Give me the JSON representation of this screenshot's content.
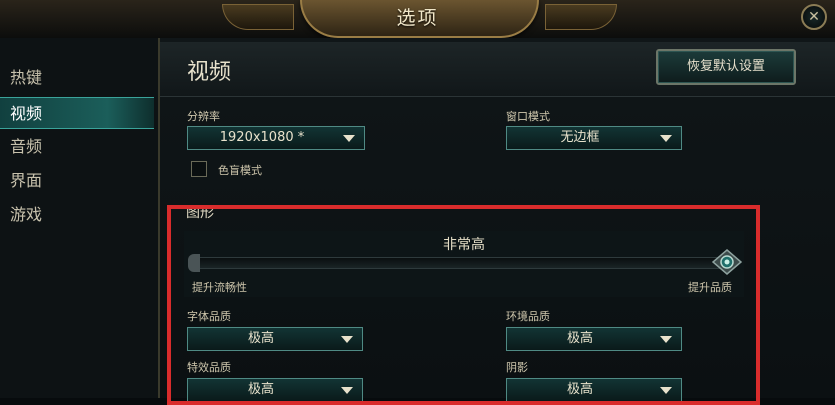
{
  "window": {
    "title": "选项",
    "close_icon": "✕"
  },
  "sidebar": {
    "items": [
      {
        "label": "热键"
      },
      {
        "label": "视频"
      },
      {
        "label": "音频"
      },
      {
        "label": "界面"
      },
      {
        "label": "游戏"
      }
    ],
    "active": "视频"
  },
  "header": {
    "title": "视频",
    "restore_defaults": "恢复默认设置"
  },
  "resolution": {
    "label": "分辨率",
    "value": "1920x1080 *"
  },
  "window_mode": {
    "label": "窗口模式",
    "value": "无边框"
  },
  "colorblind": {
    "label": "色盲模式",
    "checked": false
  },
  "graphics": {
    "title": "图形",
    "quality_level": "非常高",
    "slider_value_fraction": 1.0,
    "min_label": "提升流畅性",
    "max_label": "提升品质"
  },
  "settings": {
    "character_quality": {
      "label": "字体品质",
      "value": "极高"
    },
    "environment_quality": {
      "label": "环境品质",
      "value": "极高"
    },
    "effects_quality": {
      "label": "特效品质",
      "value": "极高"
    },
    "shadows": {
      "label": "阴影",
      "value": "极高"
    }
  },
  "colors": {
    "accent": "#3aa39a",
    "highlight": "#d92c2c"
  }
}
